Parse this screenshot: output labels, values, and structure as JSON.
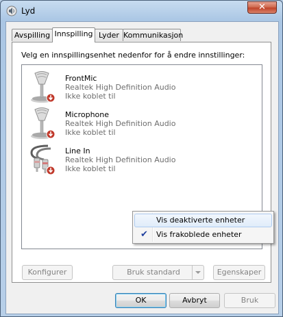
{
  "window": {
    "title": "Lyd",
    "close_glyph": "✕"
  },
  "tabs": [
    {
      "label": "Avspilling",
      "active": false
    },
    {
      "label": "Innspilling",
      "active": true
    },
    {
      "label": "Lyder",
      "active": false
    },
    {
      "label": "Kommunikasjon",
      "active": false
    }
  ],
  "panel": {
    "instruction": "Velg en innspillingsenhet nedenfor for å endre innstillinger:"
  },
  "devices": [
    {
      "name": "FrontMic",
      "driver": "Realtek High Definition Audio",
      "status": "Ikke koblet til",
      "icon": "microphone-disconnected-icon"
    },
    {
      "name": "Microphone",
      "driver": "Realtek High Definition Audio",
      "status": "Ikke koblet til",
      "icon": "microphone-disconnected-icon"
    },
    {
      "name": "Line In",
      "driver": "Realtek High Definition Audio",
      "status": "Ikke koblet til",
      "icon": "rca-cable-disconnected-icon"
    }
  ],
  "context_menu": {
    "items": [
      {
        "label": "Vis deaktiverte enheter",
        "checked": false,
        "highlighted": true
      },
      {
        "label": "Vis frakoblede enheter",
        "checked": true,
        "highlighted": false
      }
    ],
    "check_glyph": "✔"
  },
  "panel_buttons": {
    "configure": "Konfigurer",
    "set_default": "Bruk standard",
    "properties": "Egenskaper"
  },
  "dialog_buttons": {
    "ok": "OK",
    "cancel": "Avbryt",
    "apply": "Bruk"
  },
  "colors": {
    "frame": "#aac6e4",
    "close_button": "#c0442a",
    "disabled_text": "#838383",
    "menu_highlight": "#e0ecfa",
    "disconnect_badge": "#c0392b"
  }
}
